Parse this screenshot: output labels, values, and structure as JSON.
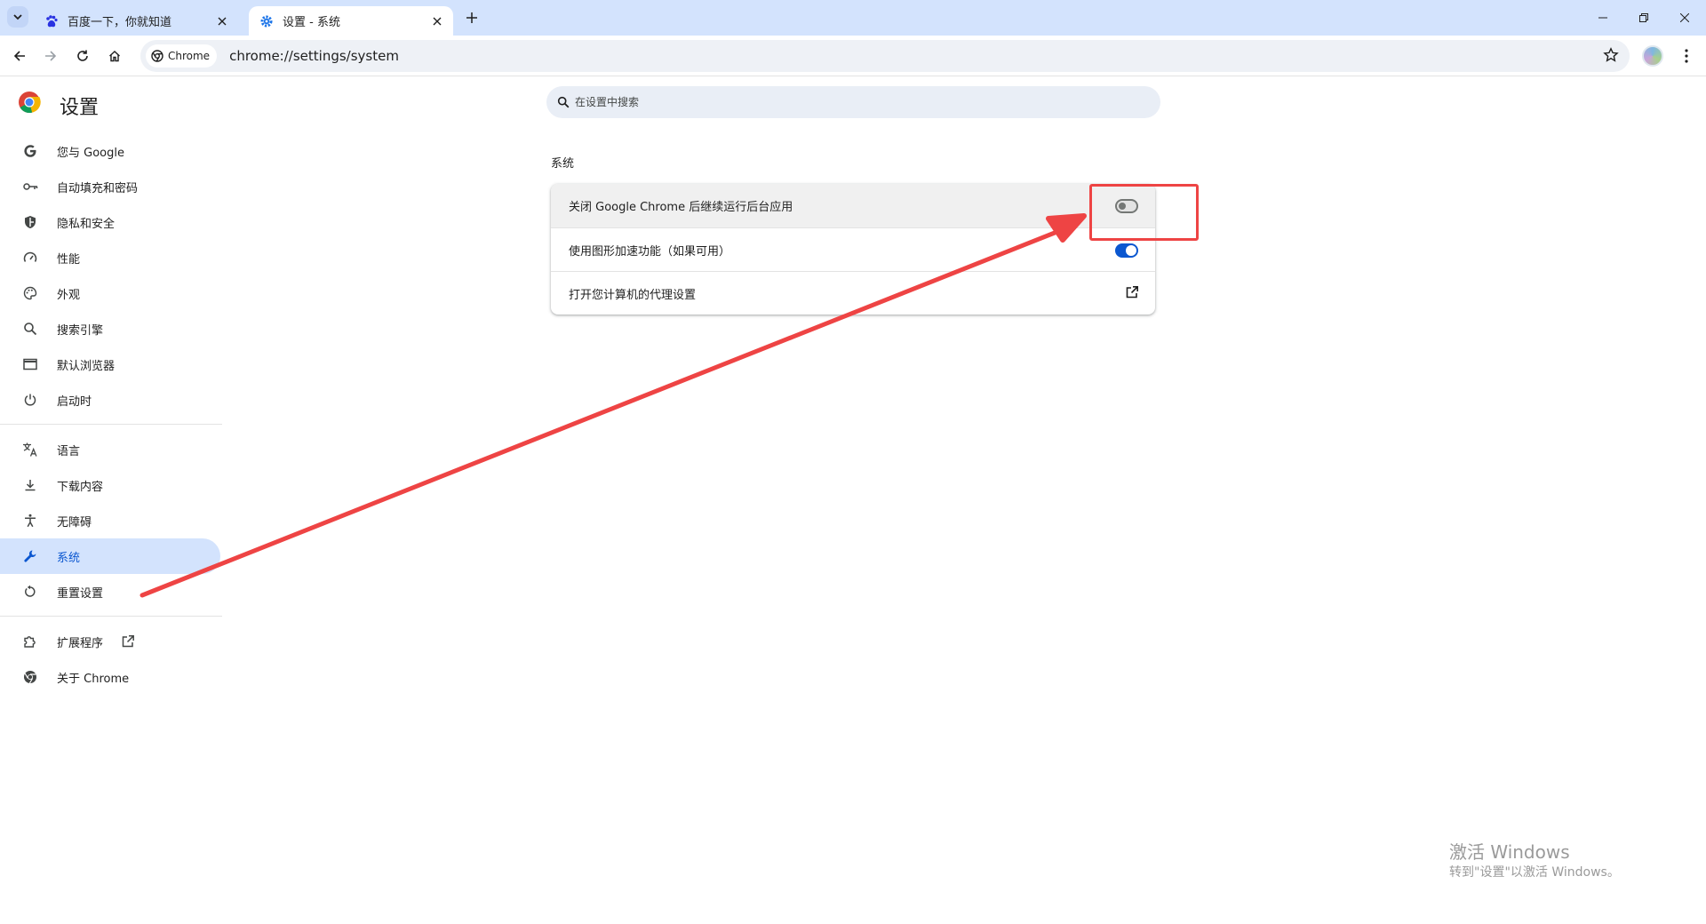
{
  "tabs": [
    {
      "title": "百度一下，你就知道",
      "favicon": "baidu-paw-icon",
      "active": false
    },
    {
      "title": "设置 - 系统",
      "favicon": "gear-icon",
      "active": true
    }
  ],
  "omnibox": {
    "chip_label": "Chrome",
    "url": "chrome://settings/system"
  },
  "settings": {
    "title": "设置",
    "search_placeholder": "在设置中搜索"
  },
  "nav": {
    "items": [
      {
        "label": "您与 Google",
        "icon": "google-g-icon"
      },
      {
        "label": "自动填充和密码",
        "icon": "key-icon"
      },
      {
        "label": "隐私和安全",
        "icon": "shield-icon"
      },
      {
        "label": "性能",
        "icon": "speedometer-icon"
      },
      {
        "label": "外观",
        "icon": "palette-icon"
      },
      {
        "label": "搜索引擎",
        "icon": "search-icon"
      },
      {
        "label": "默认浏览器",
        "icon": "browser-window-icon"
      },
      {
        "label": "启动时",
        "icon": "power-icon"
      }
    ],
    "items2": [
      {
        "label": "语言",
        "icon": "translate-icon"
      },
      {
        "label": "下载内容",
        "icon": "download-icon"
      },
      {
        "label": "无障碍",
        "icon": "accessibility-icon"
      },
      {
        "label": "系统",
        "icon": "wrench-icon",
        "selected": true
      },
      {
        "label": "重置设置",
        "icon": "reset-icon"
      }
    ],
    "items3": [
      {
        "label": "扩展程序",
        "icon": "puzzle-icon"
      },
      {
        "label": "关于 Chrome",
        "icon": "chrome-icon"
      }
    ]
  },
  "system": {
    "section_title": "系统",
    "rows": [
      {
        "label": "关闭 Google Chrome 后继续运行后台应用",
        "control": "toggle",
        "on": false
      },
      {
        "label": "使用图形加速功能（如果可用）",
        "control": "toggle",
        "on": true
      },
      {
        "label": "打开您计算机的代理设置",
        "control": "external-link"
      }
    ]
  },
  "colors": {
    "accent": "#0b57d0",
    "annotation": "#ee4444",
    "tabstrip": "#d3e3fd"
  },
  "watermark": {
    "line1": "激活 Windows",
    "line2": "转到\"设置\"以激活 Windows。"
  }
}
